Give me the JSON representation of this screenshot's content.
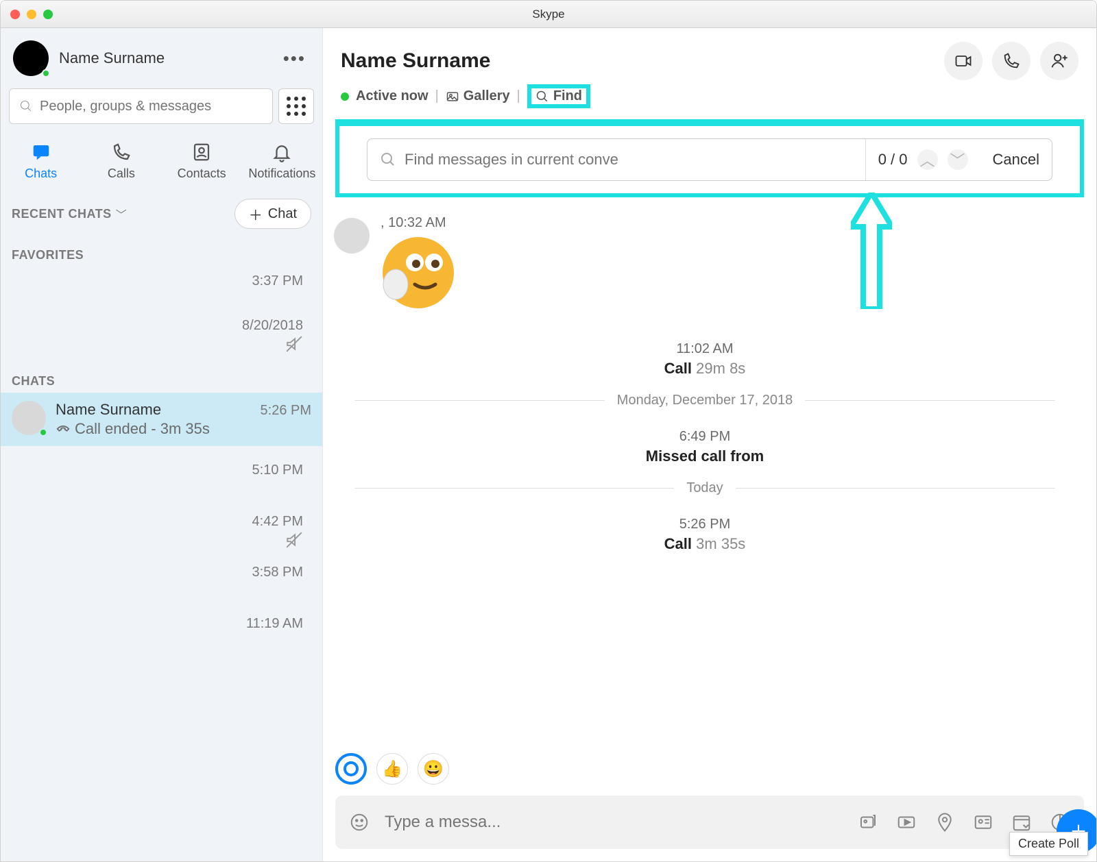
{
  "window": {
    "title": "Skype"
  },
  "profile": {
    "name": "Name Surname"
  },
  "search": {
    "placeholder": "People, groups & messages"
  },
  "tabs": {
    "chats": "Chats",
    "calls": "Calls",
    "contacts": "Contacts",
    "notifications": "Notifications"
  },
  "sections": {
    "recent": "RECENT CHATS",
    "favorites": "FAVORITES",
    "chats": "CHATS"
  },
  "new_chat": {
    "label": "Chat"
  },
  "sidebar_items": {
    "fav_time": "3:37 PM",
    "fav2_time": "8/20/2018",
    "sel_name": "Name Surname",
    "sel_time": "5:26 PM",
    "sel_snippet": "Call ended - 3m 35s",
    "t3": "5:10 PM",
    "t4": "4:42 PM",
    "t5": "3:58 PM",
    "t6": "11:19 AM"
  },
  "conversation": {
    "name": "Name Surname",
    "status": "Active now",
    "gallery": "Gallery",
    "find": "Find"
  },
  "find_panel": {
    "placeholder": "Find messages in current conve",
    "count": "0 / 0",
    "cancel": "Cancel"
  },
  "messages": {
    "m1_time": ", 10:32 AM",
    "call1_time": "11:02 AM",
    "call1_label": "Call",
    "call1_dur": "29m 8s",
    "date1": "Monday, December 17, 2018",
    "missed_time": "6:49 PM",
    "missed_label": "Missed call from",
    "date2": "Today",
    "call2_time": "5:26 PM",
    "call2_label": "Call",
    "call2_dur": "3m 35s"
  },
  "composer": {
    "placeholder": "Type a messa..."
  },
  "tooltip": {
    "text": "Create Poll"
  }
}
